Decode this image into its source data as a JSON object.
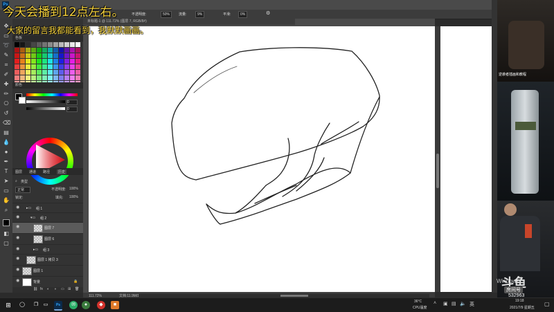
{
  "overlay": {
    "caption_line1": "今天会播到12点左右。",
    "caption_line2": "大家的留言我都能看到，我默默画画。",
    "caption_color": "#f6d23c"
  },
  "photoshop": {
    "options_bar": {
      "opacity_label": "不透明度:",
      "opacity_value": "50%",
      "flow_label": "流量:",
      "flow_value": "9%",
      "smoothing_label": "平滑:",
      "smoothing_value": "0%"
    },
    "doc_tab": "未标题-1 @ 111.72% (图层 7, RGB/8#)",
    "panels": {
      "swatches_header": "色板",
      "color_header": "颜色",
      "color_values": [
        "0",
        "0",
        "0"
      ],
      "layers_tabs": [
        "图层",
        "通道",
        "路径",
        "历史"
      ],
      "layer_filter_label": "类型",
      "blend_mode": "正常",
      "opacity_label": "不透明度:",
      "opacity_value": "100%",
      "lock_label": "锁定:",
      "fill_label": "填充:",
      "fill_value": "100%",
      "layers": [
        {
          "name": "组 1",
          "type": "group"
        },
        {
          "name": "组 2",
          "type": "group"
        },
        {
          "name": "图层 7",
          "type": "layer",
          "selected": true
        },
        {
          "name": "图层 6",
          "type": "layer"
        },
        {
          "name": "组 3",
          "type": "group"
        },
        {
          "name": "图层 1 拷贝 3",
          "type": "layer"
        },
        {
          "name": "图层 1",
          "type": "layer"
        },
        {
          "name": "背景",
          "type": "layer"
        }
      ]
    },
    "status_bar": {
      "zoom": "111.72%",
      "doc_info": "文档:11.9M/171.3M"
    }
  },
  "stream": {
    "cam_top_label": "逆袭者插画和教程",
    "logo": "斗鱼",
    "room_label": "房间号",
    "room_id": "532963",
    "windows_text": "Windows"
  },
  "taskbar": {
    "temperature": "36°C",
    "temp_label": "CPU温度",
    "time": "19:18",
    "date": "2021/7/9 星期五"
  },
  "icons": [
    "close-icon",
    "search-icon",
    "task-view-icon",
    "file-explorer-icon",
    "photoshop-icon",
    "wechat-icon",
    "chrome-icon",
    "app-icon"
  ]
}
